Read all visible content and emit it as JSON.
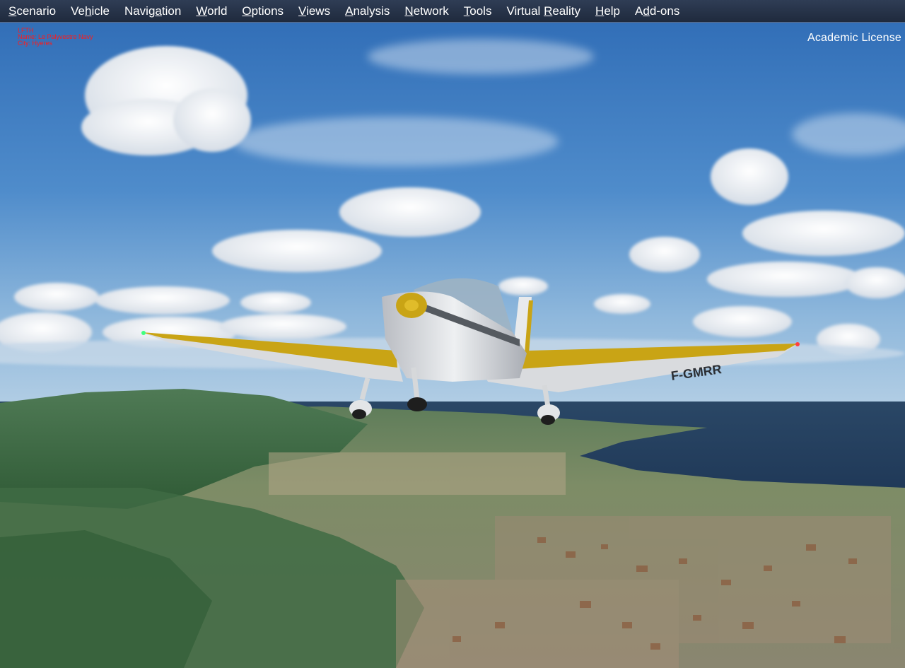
{
  "menu": {
    "items": [
      {
        "pre": "",
        "key": "S",
        "post": "cenario"
      },
      {
        "pre": "Ve",
        "key": "h",
        "post": "icle"
      },
      {
        "pre": "Navig",
        "key": "a",
        "post": "tion"
      },
      {
        "pre": "",
        "key": "W",
        "post": "orld"
      },
      {
        "pre": "",
        "key": "O",
        "post": "ptions"
      },
      {
        "pre": "",
        "key": "V",
        "post": "iews"
      },
      {
        "pre": "",
        "key": "A",
        "post": "nalysis"
      },
      {
        "pre": "",
        "key": "N",
        "post": "etwork"
      },
      {
        "pre": "",
        "key": "T",
        "post": "ools"
      },
      {
        "pre": "Virtual ",
        "key": "R",
        "post": "eality"
      },
      {
        "pre": "",
        "key": "H",
        "post": "elp"
      },
      {
        "pre": "A",
        "key": "d",
        "post": "d-ons"
      }
    ]
  },
  "airport": {
    "code": "LFTH",
    "name": "Name: Le Palyvestre Navy",
    "city": "City: Hyeres"
  },
  "license": "Academic License",
  "aircraft": {
    "registration": "F-GMRR"
  },
  "colors": {
    "menubar": "#26324a",
    "airport_text": "#ff1a1a",
    "sky": "#3f7bc0",
    "wing_yellow": "#c9a415"
  }
}
